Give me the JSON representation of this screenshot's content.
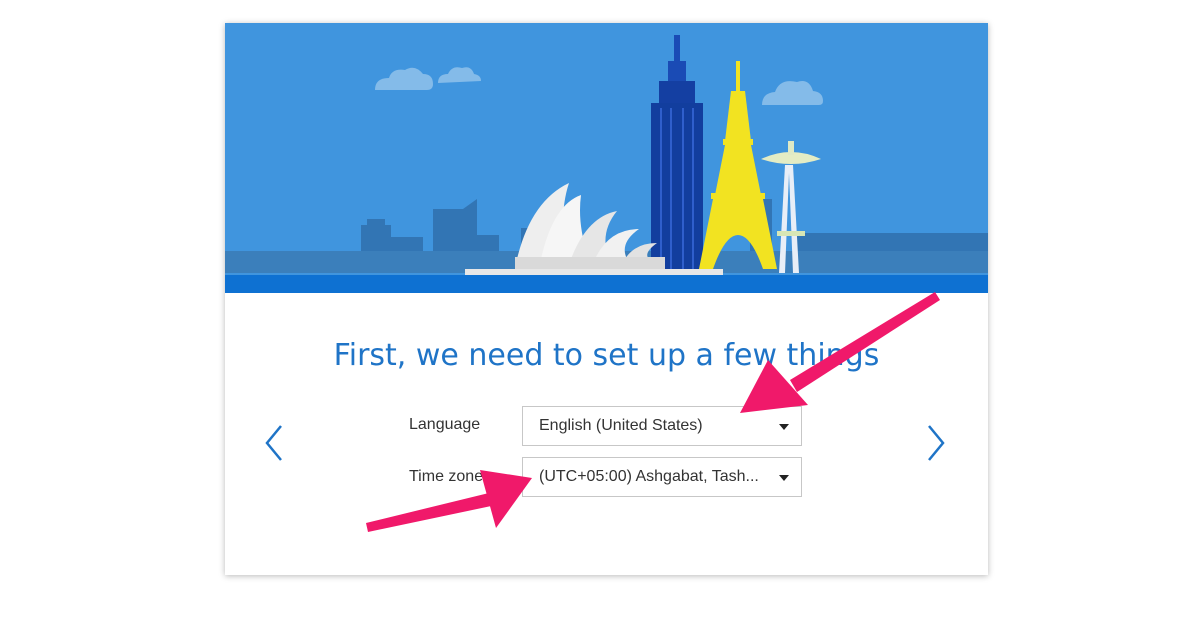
{
  "colors": {
    "sky": "#4095de",
    "accent_blue": "#1f74c7",
    "annotation_arrow": "#f0196a"
  },
  "setup": {
    "title": "First, we need to set up a few things",
    "language": {
      "label": "Language",
      "value": "English (United States)"
    },
    "timezone": {
      "label": "Time zone",
      "value": "(UTC+05:00) Ashgabat, Tash..."
    }
  },
  "nav": {
    "prev_icon": "chevron-left-icon",
    "next_icon": "chevron-right-icon"
  }
}
